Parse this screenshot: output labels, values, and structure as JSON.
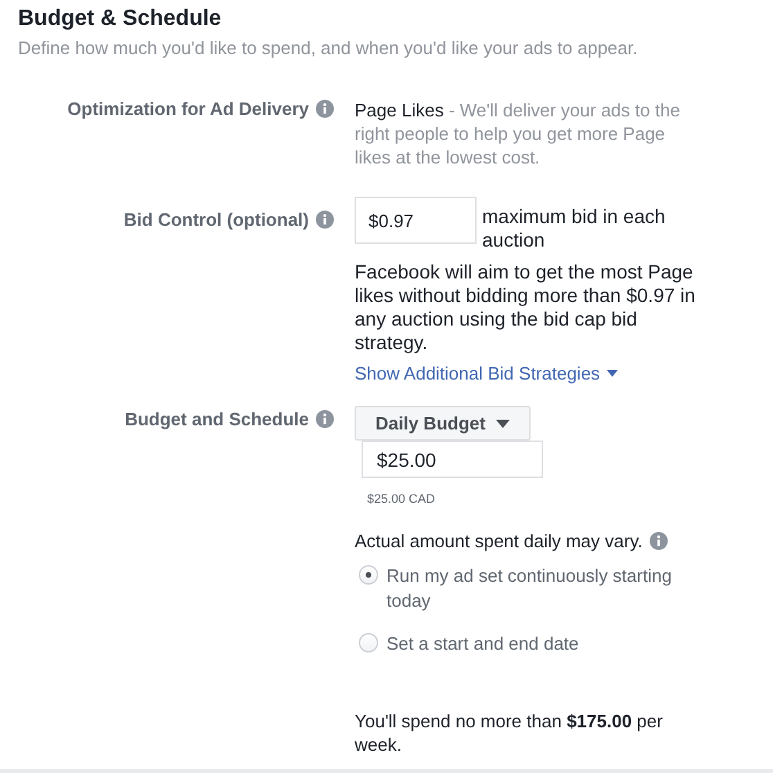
{
  "header": {
    "title": "Budget & Schedule",
    "subtitle": "Define how much you'd like to spend, and when you'd like your ads to appear."
  },
  "optimization": {
    "label": "Optimization for Ad Delivery",
    "value": "Page Likes",
    "description": " - We'll deliver your ads to the right people to help you get more Page likes at the lowest cost."
  },
  "bid_control": {
    "label": "Bid Control (optional)",
    "value": "$0.97",
    "suffix": "maximum bid in each auction",
    "note": "Facebook will aim to get the most Page likes without bidding more than $0.97 in any auction using the bid cap bid strategy.",
    "link": "Show Additional Bid Strategies"
  },
  "budget": {
    "label": "Budget and Schedule",
    "dropdown": "Daily Budget",
    "value": "$25.00",
    "currency_note": "$25.00 CAD",
    "notice": "Actual amount spent daily may vary.",
    "options": [
      {
        "label": "Run my ad set continuously starting today",
        "selected": true
      },
      {
        "label": "Set a start and end date",
        "selected": false
      }
    ],
    "summary": "You'll spend no more than **$175.00** per week."
  }
}
